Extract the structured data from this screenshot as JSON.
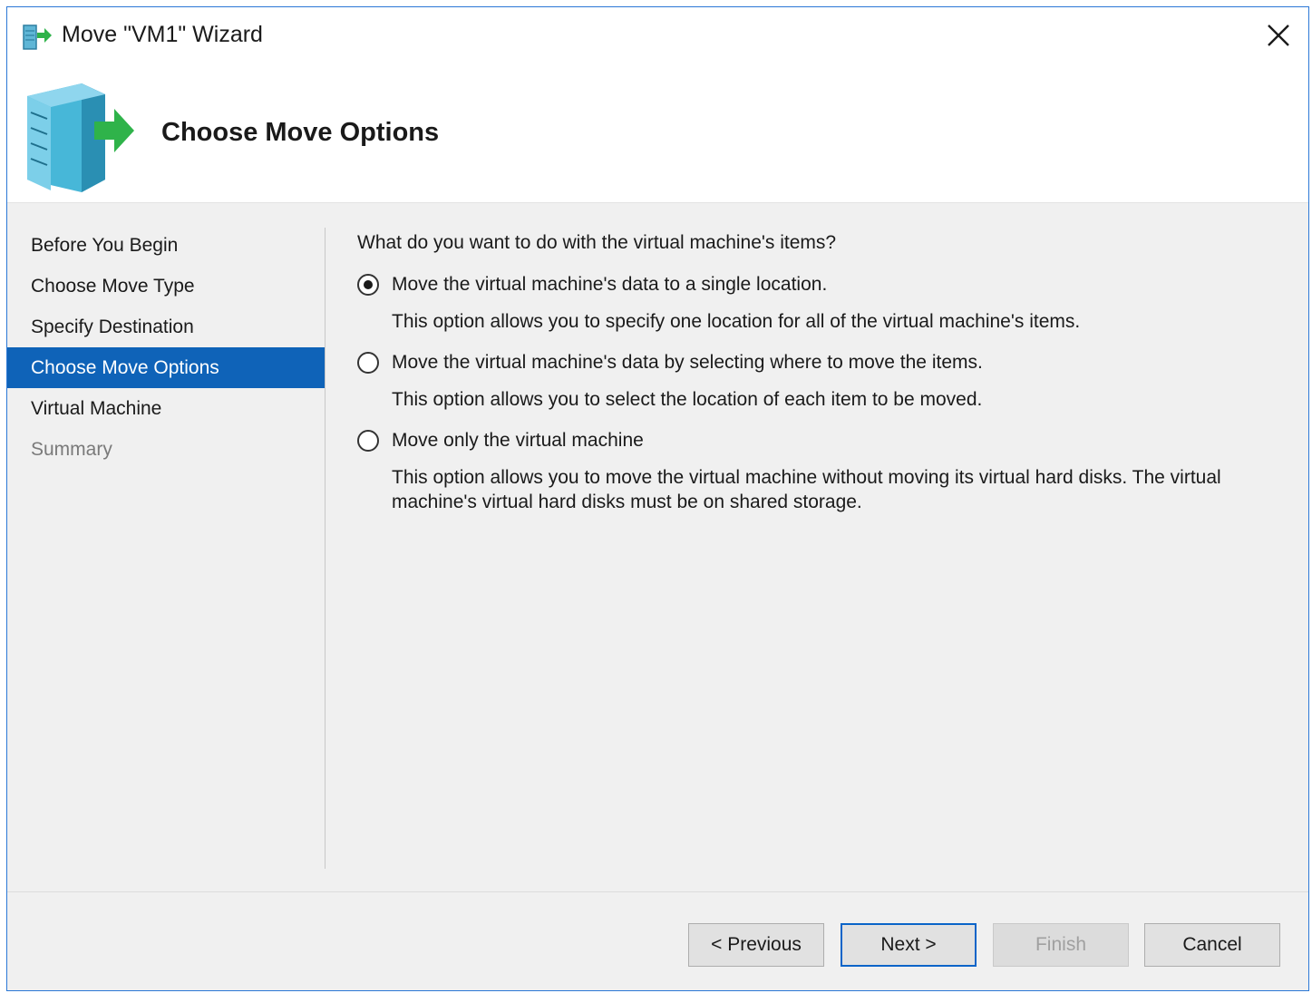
{
  "window": {
    "title": "Move \"VM1\" Wizard",
    "accent_color": "#2b78d6"
  },
  "header": {
    "title": "Choose Move Options",
    "icon": "server-move-icon"
  },
  "nav": {
    "items": [
      {
        "label": "Before You Begin",
        "state": "normal"
      },
      {
        "label": "Choose Move Type",
        "state": "normal"
      },
      {
        "label": "Specify Destination",
        "state": "normal"
      },
      {
        "label": "Choose Move Options",
        "state": "active"
      },
      {
        "label": "Virtual Machine",
        "state": "normal"
      },
      {
        "label": "Summary",
        "state": "disabled"
      }
    ],
    "active_color": "#0f63b8"
  },
  "content": {
    "question": "What do you want to do with the virtual machine's items?",
    "options": [
      {
        "label": "Move the virtual machine's data to a single location.",
        "description": "This option allows you to specify one location for all of the virtual machine's items.",
        "selected": true
      },
      {
        "label": "Move the virtual machine's data by selecting where to move the items.",
        "description": "This option allows you to select the location of each item to be moved.",
        "selected": false
      },
      {
        "label": "Move only the virtual machine",
        "description": "This option allows you to move the virtual machine without moving its virtual hard disks. The virtual machine's virtual hard disks must be on shared storage.",
        "selected": false
      }
    ]
  },
  "buttons": {
    "previous": "< Previous",
    "next": "Next >",
    "finish": "Finish",
    "cancel": "Cancel"
  }
}
